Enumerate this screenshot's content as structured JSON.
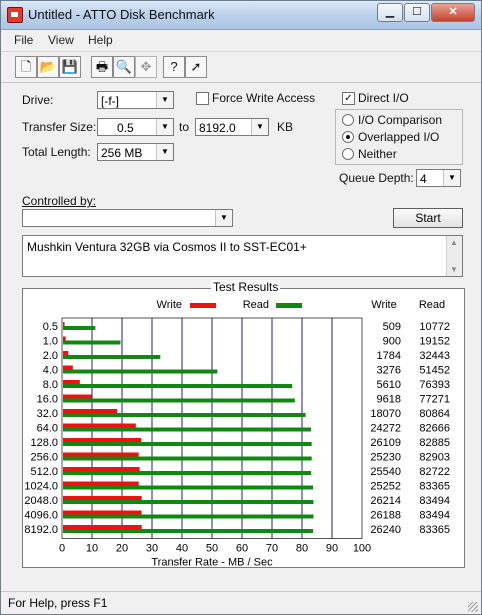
{
  "window": {
    "title": "Untitled - ATTO Disk Benchmark"
  },
  "menu": [
    "File",
    "View",
    "Help"
  ],
  "toolbar": {
    "icons": [
      "new-file-icon",
      "open-folder-icon",
      "save-icon",
      "print-icon",
      "print-preview-icon",
      "move-icon",
      "help-icon",
      "context-help-icon"
    ]
  },
  "drive": {
    "label": "Drive:",
    "value": "[-f-]"
  },
  "force_write": {
    "label": "Force Write Access",
    "checked": false
  },
  "direct_io": {
    "label": "Direct I/O",
    "checked": true
  },
  "transfer": {
    "label": "Transfer Size:",
    "from": "0.5",
    "to_label": "to",
    "to": "8192.0",
    "unit": "KB"
  },
  "total_length": {
    "label": "Total Length:",
    "value": "256 MB"
  },
  "io_mode": {
    "options": [
      "I/O Comparison",
      "Overlapped I/O",
      "Neither"
    ],
    "selected": "Overlapped I/O"
  },
  "queue_depth": {
    "label": "Queue Depth:",
    "value": "4"
  },
  "controlled_by": {
    "label": "Controlled by:",
    "value": ""
  },
  "start_button": "Start",
  "description": "Mushkin Ventura 32GB via Cosmos II to SST-EC01+",
  "results": {
    "title": "Test Results",
    "write_label": "Write",
    "read_label": "Read",
    "col_write": "Write",
    "col_read": "Read"
  },
  "colors": {
    "write": "#ee1111",
    "read": "#118811",
    "grid": "#1b1b9a"
  },
  "status": {
    "text": "For Help, press F1"
  },
  "chart_data": {
    "type": "bar",
    "orientation": "horizontal",
    "categories": [
      "0.5",
      "1.0",
      "2.0",
      "4.0",
      "8.0",
      "16.0",
      "32.0",
      "64.0",
      "128.0",
      "256.0",
      "512.0",
      "1024.0",
      "2048.0",
      "4096.0",
      "8192.0"
    ],
    "series": [
      {
        "name": "Write",
        "values": [
          509,
          900,
          1784,
          3276,
          5610,
          9618,
          18070,
          24272,
          26109,
          25230,
          25540,
          25252,
          26214,
          26188,
          26240
        ]
      },
      {
        "name": "Read",
        "values": [
          10772,
          19152,
          32443,
          51452,
          76393,
          77271,
          80864,
          82666,
          82885,
          82903,
          82722,
          83365,
          83494,
          83494,
          83365
        ]
      }
    ],
    "xlabel": "Transfer Rate - MB / Sec",
    "xticks": [
      "0",
      "10",
      "20",
      "30",
      "40",
      "50",
      "60",
      "70",
      "80",
      "90",
      "100"
    ],
    "xlim": [
      0,
      100
    ]
  }
}
